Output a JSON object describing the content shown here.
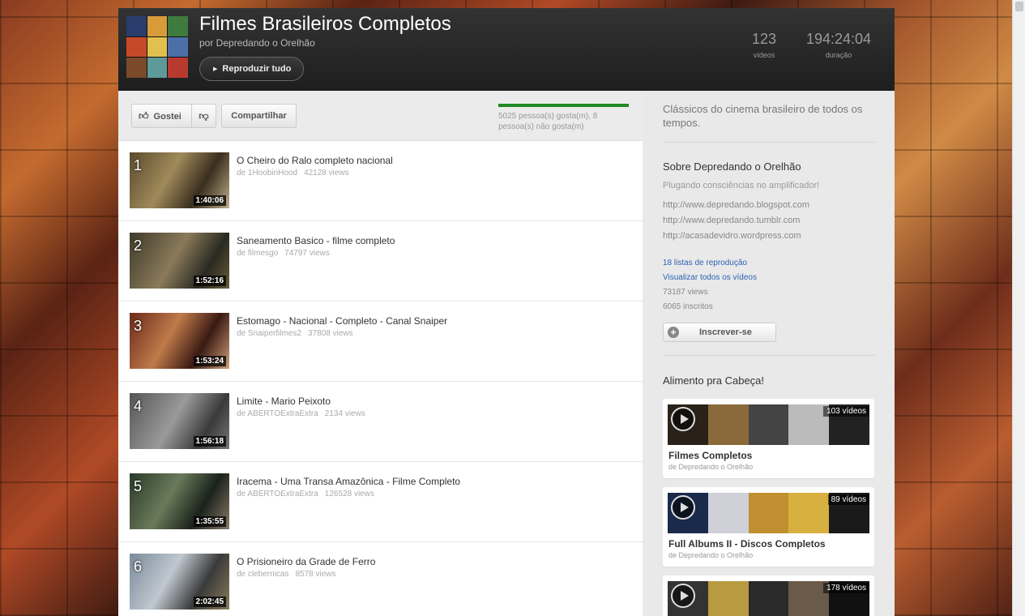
{
  "playlist": {
    "title": "Filmes Brasileiros Completos",
    "author": "por Depredando o Orelhão",
    "play_all": "Reproduzir tudo",
    "videos_count": "123",
    "videos_label": "vídeos",
    "duration": "194:24:04",
    "duration_label": "duração"
  },
  "actions": {
    "like": "Gostei",
    "share": "Compartilhar",
    "ratio_text": "5025 pessoa(s) gosta(m), 8 pessoa(s) não gosta(m)"
  },
  "videos": [
    {
      "index": "1",
      "title": "O Cheiro do Ralo completo nacional",
      "channel": "de 1HoobinHood",
      "views": "42128 views",
      "duration": "1:40:06"
    },
    {
      "index": "2",
      "title": "Saneamento Basico - filme completo",
      "channel": "de filmesgo",
      "views": "74797 views",
      "duration": "1:52:16"
    },
    {
      "index": "3",
      "title": "Estomago - Nacional - Completo - Canal Snaiper",
      "channel": "de Snaiperfilmes2",
      "views": "37808 views",
      "duration": "1:53:24"
    },
    {
      "index": "4",
      "title": "Limite - Mario Peixoto",
      "channel": "de ABERTOExtraExtra",
      "views": "2134 views",
      "duration": "1:56:18"
    },
    {
      "index": "5",
      "title": "Iracema - Uma Transa Amazônica - Filme Completo",
      "channel": "de ABERTOExtraExtra",
      "views": "126528 views",
      "duration": "1:35:55"
    },
    {
      "index": "6",
      "title": "O Prisioneiro da Grade de Ferro",
      "channel": "de clebernicas",
      "views": "8578 views",
      "duration": "2:02:45"
    }
  ],
  "sidebar": {
    "description": "Clássicos do cinema brasileiro de todos os tempos.",
    "about_title": "Sobre Depredando o Orelhão",
    "tagline": "Plugando consciências no amplificador!",
    "links": [
      "http://www.depredando.blogspot.com",
      "http://www.depredando.tumblr.com",
      "http://acasadevidro.wordpress.com"
    ],
    "playlists_link": "18 listas de reprodução",
    "all_videos_link": "Visualizar todos os vídeos",
    "views": "73187 views",
    "subscribers": "6065 inscritos",
    "subscribe": "Inscrever-se",
    "section_title": "Alimento pra Cabeça!",
    "playlist_cards": [
      {
        "title": "Filmes Completos",
        "by": "de Depredando o Orelhão",
        "count": "103 vídeos"
      },
      {
        "title": "Full Albums II - Discos Completos",
        "by": "de Depredando o Orelhão",
        "count": "89 vídeos"
      },
      {
        "title": "",
        "by": "",
        "count": "178 vídeos"
      }
    ]
  },
  "colors": {
    "header_bg": "#1e1e1e",
    "ratio_bar": "#1f8a22",
    "link_blue": "#2c62b6"
  },
  "icons": [
    "play-icon",
    "thumbs-up-icon",
    "thumbs-down-icon",
    "plus-icon"
  ]
}
